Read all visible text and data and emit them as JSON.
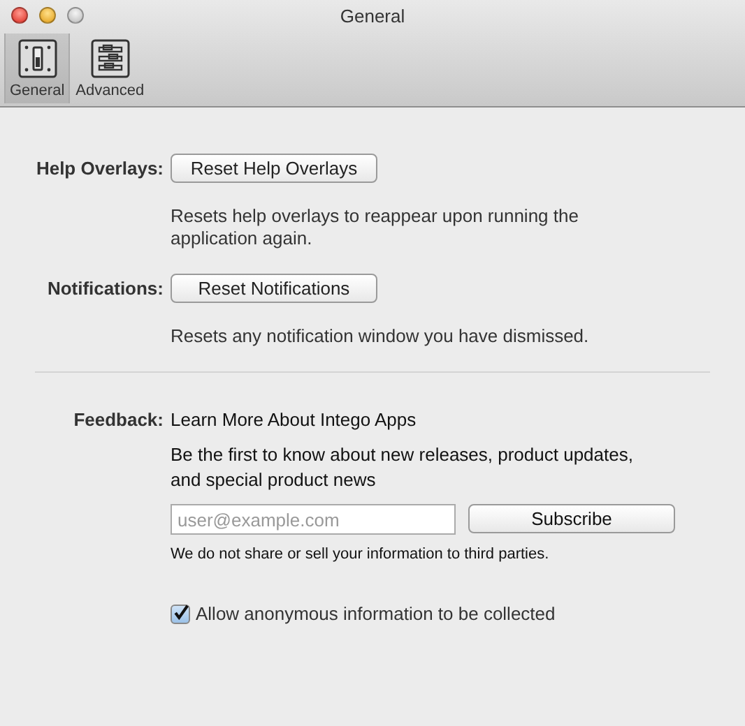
{
  "window": {
    "title": "General"
  },
  "toolbar": [
    {
      "label": "General",
      "kind": "general",
      "selected": true
    },
    {
      "label": "Advanced",
      "kind": "advanced",
      "selected": false
    }
  ],
  "settings": [
    {
      "label": "Help Overlays:",
      "button": "Reset Help Overlays",
      "description": "Resets help overlays to reappear upon running the application again."
    },
    {
      "label": "Notifications:",
      "button": "Reset Notifications",
      "description": "Resets any notification window you have dismissed."
    }
  ],
  "feedback": {
    "label": "Feedback:",
    "heading": "Learn More About Intego Apps",
    "text": "Be the first to know about new releases, product updates, and special product news",
    "email": {
      "placeholder": "user@example.com"
    },
    "button": "Subscribe",
    "note": "We do not share or sell your information to third parties.",
    "checkbox": {
      "label": "Allow anonymous information to be collected",
      "checked": true
    }
  }
}
